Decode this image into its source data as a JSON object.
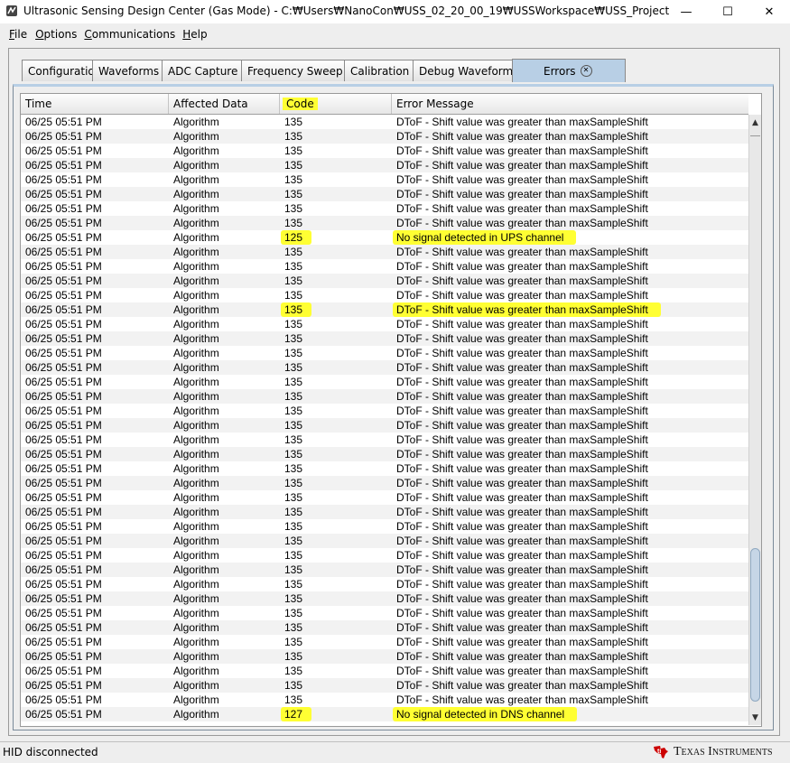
{
  "window": {
    "title": "Ultrasonic Sensing Design Center (Gas Mode) - C:₩Users₩NanoCon₩USS_02_20_00_19₩USSWorkspace₩USS_Project",
    "minimize_glyph": "—",
    "maximize_glyph": "☐",
    "close_glyph": "✕"
  },
  "menu": [
    {
      "mnemonic": "F",
      "rest": "ile"
    },
    {
      "mnemonic": "O",
      "rest": "ptions"
    },
    {
      "mnemonic": "C",
      "rest": "ommunications"
    },
    {
      "mnemonic": "H",
      "rest": "elp"
    }
  ],
  "tabs": [
    "Configuration",
    "Waveforms",
    "ADC Capture",
    "Frequency Sweep",
    "Calibration",
    "Debug Waveform",
    "Errors"
  ],
  "active_tab": "Errors",
  "table": {
    "columns": [
      "Time",
      "Affected Data",
      "Code",
      "Error Message"
    ],
    "rows": [
      [
        "06/25 05:51 PM",
        "Algorithm",
        "135",
        "DToF - Shift value was greater than maxSampleShift"
      ],
      [
        "06/25 05:51 PM",
        "Algorithm",
        "135",
        "DToF - Shift value was greater than maxSampleShift"
      ],
      [
        "06/25 05:51 PM",
        "Algorithm",
        "135",
        "DToF - Shift value was greater than maxSampleShift"
      ],
      [
        "06/25 05:51 PM",
        "Algorithm",
        "135",
        "DToF - Shift value was greater than maxSampleShift"
      ],
      [
        "06/25 05:51 PM",
        "Algorithm",
        "135",
        "DToF - Shift value was greater than maxSampleShift"
      ],
      [
        "06/25 05:51 PM",
        "Algorithm",
        "135",
        "DToF - Shift value was greater than maxSampleShift"
      ],
      [
        "06/25 05:51 PM",
        "Algorithm",
        "135",
        "DToF - Shift value was greater than maxSampleShift"
      ],
      [
        "06/25 05:51 PM",
        "Algorithm",
        "135",
        "DToF - Shift value was greater than maxSampleShift"
      ],
      [
        "06/25 05:51 PM",
        "Algorithm",
        "125",
        "No signal detected in UPS channel"
      ],
      [
        "06/25 05:51 PM",
        "Algorithm",
        "135",
        "DToF - Shift value was greater than maxSampleShift"
      ],
      [
        "06/25 05:51 PM",
        "Algorithm",
        "135",
        "DToF - Shift value was greater than maxSampleShift"
      ],
      [
        "06/25 05:51 PM",
        "Algorithm",
        "135",
        "DToF - Shift value was greater than maxSampleShift"
      ],
      [
        "06/25 05:51 PM",
        "Algorithm",
        "135",
        "DToF - Shift value was greater than maxSampleShift"
      ],
      [
        "06/25 05:51 PM",
        "Algorithm",
        "135",
        "DToF - Shift value was greater than maxSampleShift"
      ],
      [
        "06/25 05:51 PM",
        "Algorithm",
        "135",
        "DToF - Shift value was greater than maxSampleShift"
      ],
      [
        "06/25 05:51 PM",
        "Algorithm",
        "135",
        "DToF - Shift value was greater than maxSampleShift"
      ],
      [
        "06/25 05:51 PM",
        "Algorithm",
        "135",
        "DToF - Shift value was greater than maxSampleShift"
      ],
      [
        "06/25 05:51 PM",
        "Algorithm",
        "135",
        "DToF - Shift value was greater than maxSampleShift"
      ],
      [
        "06/25 05:51 PM",
        "Algorithm",
        "135",
        "DToF - Shift value was greater than maxSampleShift"
      ],
      [
        "06/25 05:51 PM",
        "Algorithm",
        "135",
        "DToF - Shift value was greater than maxSampleShift"
      ],
      [
        "06/25 05:51 PM",
        "Algorithm",
        "135",
        "DToF - Shift value was greater than maxSampleShift"
      ],
      [
        "06/25 05:51 PM",
        "Algorithm",
        "135",
        "DToF - Shift value was greater than maxSampleShift"
      ],
      [
        "06/25 05:51 PM",
        "Algorithm",
        "135",
        "DToF - Shift value was greater than maxSampleShift"
      ],
      [
        "06/25 05:51 PM",
        "Algorithm",
        "135",
        "DToF - Shift value was greater than maxSampleShift"
      ],
      [
        "06/25 05:51 PM",
        "Algorithm",
        "135",
        "DToF - Shift value was greater than maxSampleShift"
      ],
      [
        "06/25 05:51 PM",
        "Algorithm",
        "135",
        "DToF - Shift value was greater than maxSampleShift"
      ],
      [
        "06/25 05:51 PM",
        "Algorithm",
        "135",
        "DToF - Shift value was greater than maxSampleShift"
      ],
      [
        "06/25 05:51 PM",
        "Algorithm",
        "135",
        "DToF - Shift value was greater than maxSampleShift"
      ],
      [
        "06/25 05:51 PM",
        "Algorithm",
        "135",
        "DToF - Shift value was greater than maxSampleShift"
      ],
      [
        "06/25 05:51 PM",
        "Algorithm",
        "135",
        "DToF - Shift value was greater than maxSampleShift"
      ],
      [
        "06/25 05:51 PM",
        "Algorithm",
        "135",
        "DToF - Shift value was greater than maxSampleShift"
      ],
      [
        "06/25 05:51 PM",
        "Algorithm",
        "135",
        "DToF - Shift value was greater than maxSampleShift"
      ],
      [
        "06/25 05:51 PM",
        "Algorithm",
        "135",
        "DToF - Shift value was greater than maxSampleShift"
      ],
      [
        "06/25 05:51 PM",
        "Algorithm",
        "135",
        "DToF - Shift value was greater than maxSampleShift"
      ],
      [
        "06/25 05:51 PM",
        "Algorithm",
        "135",
        "DToF - Shift value was greater than maxSampleShift"
      ],
      [
        "06/25 05:51 PM",
        "Algorithm",
        "135",
        "DToF - Shift value was greater than maxSampleShift"
      ],
      [
        "06/25 05:51 PM",
        "Algorithm",
        "135",
        "DToF - Shift value was greater than maxSampleShift"
      ],
      [
        "06/25 05:51 PM",
        "Algorithm",
        "135",
        "DToF - Shift value was greater than maxSampleShift"
      ],
      [
        "06/25 05:51 PM",
        "Algorithm",
        "135",
        "DToF - Shift value was greater than maxSampleShift"
      ],
      [
        "06/25 05:51 PM",
        "Algorithm",
        "135",
        "DToF - Shift value was greater than maxSampleShift"
      ],
      [
        "06/25 05:51 PM",
        "Algorithm",
        "135",
        "DToF - Shift value was greater than maxSampleShift"
      ],
      [
        "06/25 05:51 PM",
        "Algorithm",
        "127",
        "No signal detected in DNS channel"
      ]
    ],
    "highlighted_rows": [
      8,
      13,
      41
    ],
    "highlight_color": "#ffff33"
  },
  "status": {
    "text": "HID disconnected",
    "logo_text": "Texas Instruments",
    "logo_color": "#cc0000"
  },
  "scrollbar": {
    "up_glyph": "▲",
    "down_glyph": "▼"
  }
}
